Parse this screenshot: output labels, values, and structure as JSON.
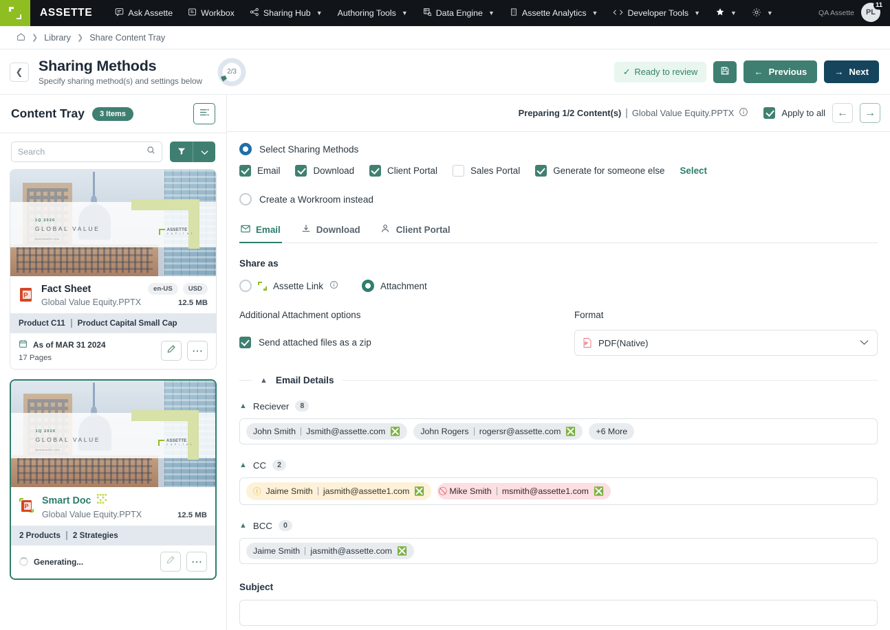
{
  "topnav": {
    "brand": "ASSETTE",
    "items": [
      {
        "label": "Ask Assette",
        "icon": "chat-icon",
        "caret": false
      },
      {
        "label": "Workbox",
        "icon": "workbox-icon",
        "caret": false
      },
      {
        "label": "Sharing Hub",
        "icon": "share-icon",
        "caret": true
      },
      {
        "label": "Authoring Tools",
        "icon": "authoring-icon",
        "caret": true
      },
      {
        "label": "Data Engine",
        "icon": "data-engine-icon",
        "caret": true
      },
      {
        "label": "Assette Analytics",
        "icon": "analytics-icon",
        "caret": true
      },
      {
        "label": "Developer Tools",
        "icon": "code-icon",
        "caret": true
      }
    ],
    "star_icon": "star-icon",
    "gear_icon": "gear-icon",
    "user_label": "QA Assette",
    "avatar_initials": "PL",
    "avatar_badge": "11"
  },
  "breadcrumb": {
    "home_icon": "home-icon",
    "items": [
      "Library",
      "Share Content Tray"
    ]
  },
  "pagehead": {
    "back_icon": "chevron-left-icon",
    "title": "Sharing Methods",
    "subtitle": "Specify sharing method(s) and settings below",
    "progress_label": "2/3",
    "progress_value": 2,
    "progress_total": 3,
    "ready_label": "Ready to review",
    "save_icon": "save-icon",
    "previous_label": "Previous",
    "next_label": "Next"
  },
  "sidebar": {
    "title": "Content Tray",
    "count_badge": "3 Items",
    "list_toggle_icon": "list-settings-icon",
    "search_placeholder": "Search",
    "search_value": "",
    "search_icon": "search-icon",
    "filter_icon": "funnel-icon",
    "filter_caret_icon": "chevron-down-icon",
    "cards": [
      {
        "title": "Fact Sheet",
        "title_color": "#1d2936",
        "file": "Global Value Equity.PPTX",
        "size": "12.5 MB",
        "tags": [
          "en-US",
          "USD"
        ],
        "meta_left": "Product C11",
        "meta_right": "Product Capital Small Cap",
        "date_icon": "calendar-icon",
        "date": "As of MAR 31 2024",
        "pages": "17 Pages",
        "status": "",
        "selected": false,
        "thumb_quarter": "1Q 2020",
        "thumb_title": "GLOBAL VALUE",
        "thumb_url": "www.assette.com",
        "thumb_logo": "ASSETTE",
        "thumb_logo_sub": "C A P I T A L"
      },
      {
        "title": "Smart Doc",
        "title_color": "#2d7d6b",
        "smart_icon": "smart-doc-icon",
        "file": "Global Value Equity.PPTX",
        "size": "12.5 MB",
        "tags": [],
        "meta_left": "2 Products",
        "meta_right": "2 Strategies",
        "date": "",
        "pages": "",
        "status": "Generating...",
        "selected": true,
        "thumb_quarter": "1Q 2020",
        "thumb_title": "GLOBAL VALUE",
        "thumb_url": "www.assette.com",
        "thumb_logo": "ASSETTE",
        "thumb_logo_sub": "C A P I T A L"
      }
    ],
    "edit_icon": "edit-pen-icon",
    "more_icon": "ellipsis-icon"
  },
  "main": {
    "preparing_bold": "Preparing 1/2 Content(s)",
    "preparing_file": "Global Value Equity.PPTX",
    "info_icon": "info-icon",
    "apply_to_all_label": "Apply to all",
    "apply_to_all_checked": true,
    "prev_arrow_icon": "arrow-left-icon",
    "next_arrow_icon": "arrow-right-icon",
    "select_sharing_label": "Select Sharing Methods",
    "select_sharing_selected": true,
    "methods": [
      {
        "label": "Email",
        "checked": true
      },
      {
        "label": "Download",
        "checked": true
      },
      {
        "label": "Client Portal",
        "checked": true
      },
      {
        "label": "Sales Portal",
        "checked": false
      },
      {
        "label": "Generate for someone else",
        "checked": true
      }
    ],
    "select_link": "Select",
    "workroom_label": "Create a Workroom instead",
    "workroom_selected": false,
    "tabs": [
      {
        "label": "Email",
        "icon": "envelope-icon",
        "active": true
      },
      {
        "label": "Download",
        "icon": "download-icon",
        "active": false
      },
      {
        "label": "Client Portal",
        "icon": "person-icon",
        "active": false
      }
    ],
    "share_as_label": "Share as",
    "share_as_options": [
      {
        "label": "Assette Link",
        "selected": false,
        "has_info": true
      },
      {
        "label": "Attachment",
        "selected": true,
        "has_info": false
      }
    ],
    "attachment_options_label": "Additional Attachment options",
    "zip_label": "Send attached files as a zip",
    "zip_checked": true,
    "format_label": "Format",
    "format_value": "PDF(Native)",
    "format_icon": "pdf-icon",
    "email_details_label": "Email Details",
    "fields": [
      {
        "name": "Reciever",
        "count": "8",
        "chips": [
          {
            "name": "John Smith",
            "email": "Jsmith@assette.com",
            "state": "normal"
          },
          {
            "name": "John Rogers",
            "email": "rogersr@assette.com",
            "state": "normal"
          }
        ],
        "more": "+6 More"
      },
      {
        "name": "CC",
        "count": "2",
        "chips": [
          {
            "name": "Jaime Smith",
            "email": "jasmith@assette1.com",
            "state": "warn"
          },
          {
            "name": "Mike Smith",
            "email": "msmith@assette1.com",
            "state": "error"
          }
        ],
        "more": ""
      },
      {
        "name": "BCC",
        "count": "0",
        "chips": [
          {
            "name": "Jaime Smith",
            "email": "jasmith@assette.com",
            "state": "normal"
          }
        ],
        "more": ""
      }
    ],
    "subject_label": "Subject",
    "subject_value": "",
    "subject_placeholder": ""
  },
  "colors": {
    "brand_green": "#8fbe23",
    "teal": "#3f7f72",
    "teal_dark": "#2d7d6b",
    "navy": "#14455c",
    "nav_bg": "#111418",
    "ready_bg": "#e8f6ef",
    "ready_text": "#35806a"
  }
}
